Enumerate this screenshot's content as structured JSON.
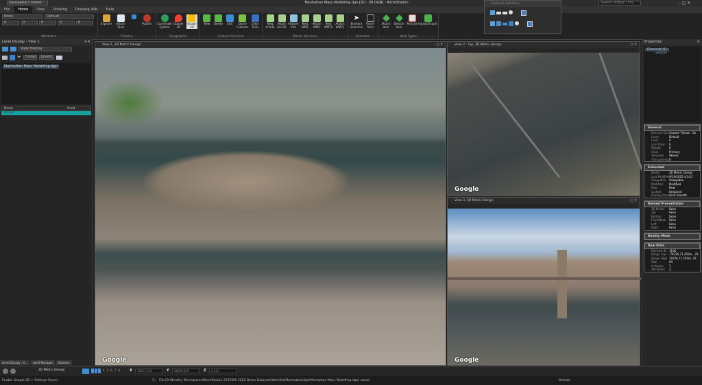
{
  "window": {
    "title": "Manhattan Mass Modelling.dgn [3D - V8 DGN] - MicroStation",
    "workflow": "Geospatial Context",
    "search_placeholder": "Search Ribbon (F4)"
  },
  "tabs": [
    "File",
    "Home",
    "View",
    "Drawing",
    "Drawing Aids",
    "Help"
  ],
  "active_tab": "Home",
  "ribbon": {
    "attributes": {
      "label": "Attributes",
      "level": "None",
      "style": "Default",
      "fields": [
        "0",
        "0",
        "0",
        "0",
        "0"
      ]
    },
    "primary": {
      "label": "Primary",
      "buttons": [
        "Explorer",
        "Attach Tools",
        "PopSet"
      ]
    },
    "geographic": {
      "label": "Geographic",
      "buttons": [
        "Coordinate System",
        "Google 3D",
        "Google 3D"
      ]
    },
    "feature_services": {
      "label": "Feature Services",
      "buttons": [
        "New",
        "Delete",
        "Edit",
        "Query Features",
        "Clear Tools"
      ]
    },
    "raster_services": {
      "label": "Raster Services",
      "buttons": [
        "New ArcGIS",
        "Attach ArcGIS",
        "Feature Info",
        "New WMS",
        "Attach WMS",
        "New WMTS",
        "Attach WMTS"
      ]
    },
    "selection": {
      "label": "Selection",
      "buttons": [
        "Element Selection",
        "Fence Tools"
      ]
    },
    "item_types": {
      "label": "Item Types",
      "buttons": [
        "Attach Item",
        "Detach Item",
        "PickList",
        "Import/Export"
      ]
    }
  },
  "element_selection": {
    "title": "Element Selection"
  },
  "left_panel": {
    "title": "Level Display - View 1",
    "display": "View Display",
    "filter": "(none)",
    "levels": "Levels",
    "file": "Manhattan Mass Modelling.dgn",
    "columns": [
      "Name",
      "Used"
    ],
    "selected_row": "Default",
    "bottom_tabs": [
      "Level Display - V...",
      "Level Manager",
      "Explorer"
    ]
  },
  "views": [
    {
      "title": "View 1, 3D Metric Design"
    },
    {
      "title": "View 2 - Top, 3D Metric Design"
    },
    {
      "title": "View 3, 3D Metric Design"
    }
  ],
  "google_logo": "Google",
  "properties": {
    "title": "Properties",
    "tree_root": "Elements (1)",
    "tree_child": "rootJson",
    "sections": [
      {
        "title": "General",
        "rows": [
          [
            "Element Description",
            "Custom Tileset : Go"
          ],
          [
            "Level",
            "Default"
          ],
          [
            "Color",
            "0"
          ],
          [
            "Line Style",
            "0"
          ],
          [
            "Weight",
            "0"
          ],
          [
            "Class",
            "Primary"
          ],
          [
            "Template",
            "(None)"
          ],
          [
            "Transparency",
            "0"
          ]
        ]
      },
      {
        "title": "Extended",
        "rows": [
          [
            "Model",
            "3D Metric Design"
          ],
          [
            "Last Modified",
            "9/19/2025 4:14:2"
          ],
          [
            "Snappable",
            "Snappable"
          ],
          [
            "Modified",
            "Modified"
          ],
          [
            "New",
            "New"
          ],
          [
            "Locked",
            "Unlocked"
          ],
          [
            "Display Style",
            "Unlit Smooth"
          ]
        ]
      },
      {
        "title": "Named Presentation",
        "rows": [
          [
            "3D Model",
            "False"
          ],
          [
            "Top",
            "False"
          ],
          [
            "Bottom",
            "False"
          ],
          [
            "Front/Back",
            "False"
          ],
          [
            "Left",
            "False"
          ],
          [
            "Right",
            "False"
          ]
        ]
      },
      {
        "title": "Reality Mesh",
        "rows": []
      },
      {
        "title": "Raw Data",
        "rows": [
          [
            "Element ID",
            "1106"
          ],
          [
            "Range Low",
            "-79726.71.250m, -79"
          ],
          [
            "Range High",
            "79726.71.250m, 79"
          ],
          [
            "Size",
            "64"
          ],
          [
            "Linkages",
            "1"
          ],
          [
            "Attributes",
            "2"
          ]
        ]
      }
    ]
  },
  "bottom_toolbar": {
    "model": "3D Metric Design",
    "view_numbers": [
      "4",
      "5",
      "6",
      "7",
      "8"
    ],
    "x_label": "X",
    "x": "58521.520",
    "y_label": "Y",
    "y": "58658.856",
    "z_label": "Z",
    "z": "2.611"
  },
  "status": {
    "message": "Enable Google 3D > Settings Saved",
    "file": "File [D:\\Bentley Workspaces\\MicroStation 2025\\MS 2025 Demo Datasets\\WorkSet\\Manhattan\\dgn\\Manhattan Mass Modelling.dgn] saved",
    "level": "Default"
  }
}
